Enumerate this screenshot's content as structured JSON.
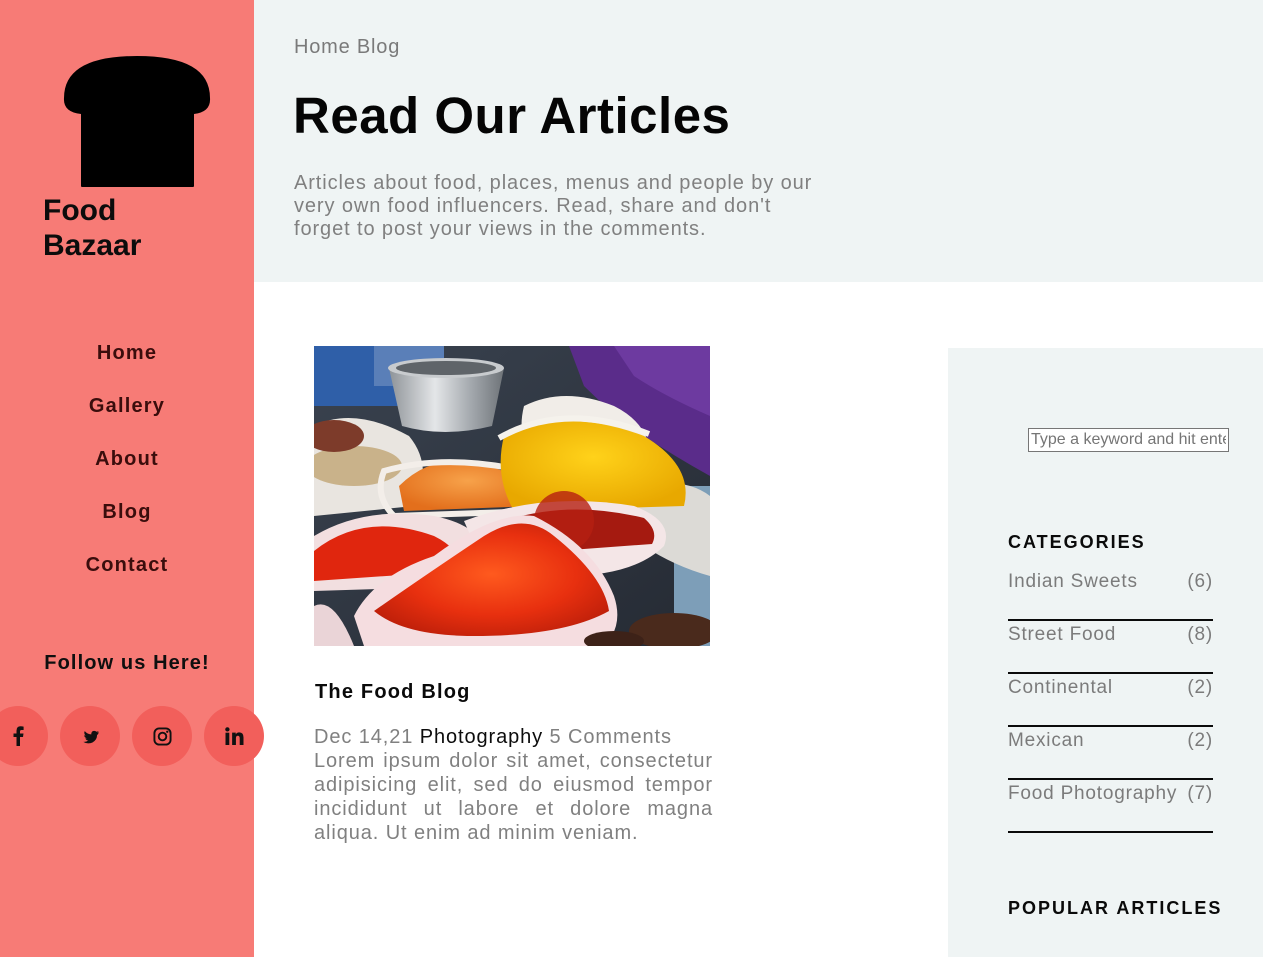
{
  "brand": {
    "name_line1": "Food",
    "name_line2": "Bazaar",
    "logo_icon": "bread-icon"
  },
  "colors": {
    "sidebar_bg": "#f77b76",
    "social_bg": "#f25f5b",
    "hero_bg": "#eff4f4",
    "aside_bg": "#eff4f4",
    "nav_text": "#3a0d0c",
    "muted_text": "#808080"
  },
  "nav": {
    "items": [
      {
        "label": "Home"
      },
      {
        "label": "Gallery"
      },
      {
        "label": "About"
      },
      {
        "label": "Blog"
      },
      {
        "label": "Contact"
      }
    ]
  },
  "social": {
    "heading": "Follow us Here!",
    "icons": [
      "facebook-icon",
      "twitter-icon",
      "instagram-icon",
      "linkedin-icon"
    ]
  },
  "hero": {
    "breadcrumb": [
      "Home",
      "Blog"
    ],
    "title": "Read Our Articles",
    "intro": "Articles about food, places, menus and people by our very own food influencers. Read, share and don't forget to post your views in the comments."
  },
  "post": {
    "image_subject": "spices-photo",
    "title": "The Food Blog",
    "date": "Dec 14,21",
    "category": "Photography",
    "comments": "5 Comments",
    "excerpt": "Lorem ipsum dolor sit amet, consectetur adipisicing elit, sed do eiusmod tempor incididunt ut labore et dolore magna aliqua. Ut enim ad minim veniam."
  },
  "aside": {
    "search_placeholder": "Type a keyword and hit enter",
    "categories_heading": "CATEGORIES",
    "categories": [
      {
        "name": "Indian Sweets",
        "count": "(6)"
      },
      {
        "name": "Street Food",
        "count": "(8)"
      },
      {
        "name": "Continental",
        "count": "(2)"
      },
      {
        "name": "Mexican",
        "count": "(2)"
      },
      {
        "name": "Food Photography",
        "count": "(7)"
      }
    ],
    "popular_heading": "POPULAR ARTICLES"
  }
}
